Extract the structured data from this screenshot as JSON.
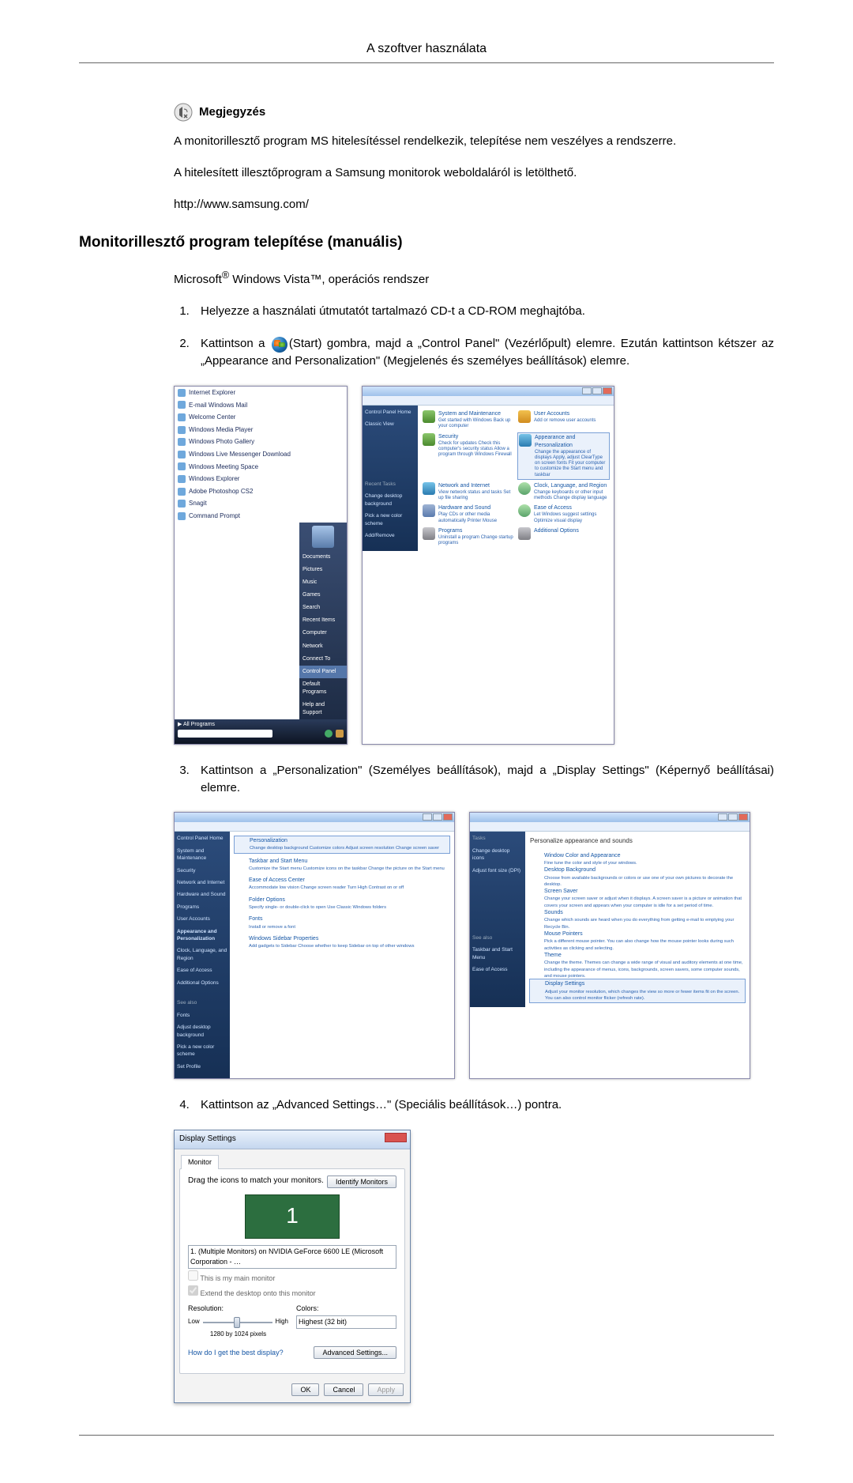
{
  "header": {
    "title": "A szoftver használata"
  },
  "note": {
    "label": "Megjegyzés",
    "p1": "A monitorillesztő program MS hitelesítéssel rendelkezik, telepítése nem veszélyes a rendszerre.",
    "p2": "A hitelesített illesztőprogram a Samsung monitorok weboldaláról is letölthető.",
    "url": "http://www.samsung.com/"
  },
  "section_title": "Monitorillesztő program telepítése (manuális)",
  "subtitle_pre": "Microsoft",
  "subtitle_post": " Windows Vista™, operációs rendszer",
  "steps": {
    "s1": "Helyezze a használati útmutatót tartalmazó CD-t a CD-ROM meghajtóba.",
    "s2_pre": "Kattintson a ",
    "s2_post": "(Start) gombra, majd a „Control Panel\" (Vezérlőpult) elemre. Ezután kattintson kétszer az „Appearance and Personalization\" (Megjelenés és személyes beállítások) elemre.",
    "s3": "Kattintson a „Personalization\" (Személyes beállítások), majd a „Display Settings\" (Képernyő beállításai) elemre.",
    "s4": "Kattintson az „Advanced Settings…\" (Speciális beállítások…) pontra."
  },
  "startmenu": {
    "items": [
      "Internet Explorer",
      "E-mail Windows Mail",
      "Welcome Center",
      "Windows Media Player",
      "Windows Photo Gallery",
      "Windows Live Messenger Download",
      "Windows Meeting Space",
      "Windows Explorer",
      "Adobe Photoshop CS2",
      "Snagit",
      "Command Prompt"
    ],
    "all_programs": "All Programs",
    "right_items": [
      "Documents",
      "Pictures",
      "Music",
      "Games",
      "Search",
      "Recent Items",
      "Computer",
      "Network",
      "Connect To",
      "Control Panel",
      "Default Programs",
      "Help and Support"
    ],
    "highlight_index": 9,
    "user_icon_alt": "user-avatar"
  },
  "controlpanel": {
    "side": {
      "home": "Control Panel Home",
      "classic": "Classic View",
      "recent": "Recent Tasks",
      "r1": "Change desktop background",
      "r2": "Pick a new color scheme",
      "r3": "Add/Remove"
    },
    "cats": [
      {
        "h": "System and Maintenance",
        "s": "Get started with Windows\nBack up your computer"
      },
      {
        "h": "User Accounts",
        "s": "Add or remove user accounts"
      },
      {
        "h": "Security",
        "s": "Check for updates\nCheck this computer's security status\nAllow a program through Windows Firewall"
      },
      {
        "h": "Appearance and Personalization",
        "s": "Change the appearance of displays\nApply, adjust ClearType on screen fonts\nFit your computer to customize the Start menu and taskbar"
      },
      {
        "h": "Network and Internet",
        "s": "View network status and tasks\nSet up file sharing"
      },
      {
        "h": "Clock, Language, and Region",
        "s": "Change keyboards or other input methods\nChange display language"
      },
      {
        "h": "Hardware and Sound",
        "s": "Play CDs or other media automatically\nPrinter\nMouse"
      },
      {
        "h": "Ease of Access",
        "s": "Let Windows suggest settings\nOptimize visual display"
      },
      {
        "h": "Programs",
        "s": "Uninstall a program\nChange startup programs"
      },
      {
        "h": "Additional Options",
        "s": ""
      }
    ],
    "hl_index": 3
  },
  "personal_left": {
    "side_links": [
      "Control Panel Home",
      "System and Maintenance",
      "Security",
      "Network and Internet",
      "Hardware and Sound",
      "Programs",
      "User Accounts",
      "Appearance and Personalization",
      "Clock, Language, and Region",
      "Ease of Access",
      "Additional Options"
    ],
    "side_sel": 7,
    "see_also": "See also",
    "see_links": [
      "Fonts",
      "Adjust desktop background",
      "Pick a new color scheme",
      "Set Profile"
    ],
    "items": [
      {
        "h": "Personalization",
        "s": "Change desktop background   Customize colors   Adjust screen resolution   Change screen saver"
      },
      {
        "h": "Taskbar and Start Menu",
        "s": "Customize the Start menu   Customize icons on the taskbar   Change the picture on the Start menu"
      },
      {
        "h": "Ease of Access Center",
        "s": "Accommodate low vision   Change screen reader   Turn High Contrast on or off"
      },
      {
        "h": "Folder Options",
        "s": "Specify single- or double-click to open   Use Classic Windows folders"
      },
      {
        "h": "Fonts",
        "s": "Install or remove a font"
      },
      {
        "h": "Windows Sidebar Properties",
        "s": "Add gadgets to Sidebar   Choose whether to keep Sidebar on top of other windows"
      }
    ],
    "hl_index": 0
  },
  "personal_right": {
    "side": {
      "tasks": "Tasks",
      "t1": "Change desktop icons",
      "t2": "Adjust font size (DPI)"
    },
    "see_also": "See also",
    "see_links": [
      "Taskbar and Start Menu",
      "Ease of Access"
    ],
    "heading": "Personalize appearance and sounds",
    "items": [
      {
        "h": "Window Color and Appearance",
        "s": "Fine tune the color and style of your windows."
      },
      {
        "h": "Desktop Background",
        "s": "Choose from available backgrounds or colors or use one of your own pictures to decorate the desktop."
      },
      {
        "h": "Screen Saver",
        "s": "Change your screen saver or adjust when it displays. A screen saver is a picture or animation that covers your screen and appears when your computer is idle for a set period of time."
      },
      {
        "h": "Sounds",
        "s": "Change which sounds are heard when you do everything from getting e-mail to emptying your Recycle Bin."
      },
      {
        "h": "Mouse Pointers",
        "s": "Pick a different mouse pointer. You can also change how the mouse pointer looks during such activities as clicking and selecting."
      },
      {
        "h": "Theme",
        "s": "Change the theme. Themes can change a wide range of visual and auditory elements at one time, including the appearance of menus, icons, backgrounds, screen savers, some computer sounds, and mouse pointers."
      },
      {
        "h": "Display Settings",
        "s": "Adjust your monitor resolution, which changes the view so more or fewer items fit on the screen. You can also control monitor flicker (refresh rate)."
      }
    ],
    "hl_index": 6
  },
  "dlg": {
    "title": "Display Settings",
    "tab": "Monitor",
    "drag": "Drag the icons to match your monitors.",
    "identify": "Identify Monitors",
    "monitor_num": "1",
    "combo": "1. (Multiple Monitors) on NVIDIA GeForce 6600 LE (Microsoft Corporation - …",
    "chk_main": "This is my main monitor",
    "chk_extend": "Extend the desktop onto this monitor",
    "res_label": "Resolution:",
    "res_low": "Low",
    "res_high": "High",
    "res_value": "1280 by 1024 pixels",
    "color_label": "Colors:",
    "color_value": "Highest (32 bit)",
    "help": "How do I get the best display?",
    "advanced": "Advanced Settings...",
    "ok": "OK",
    "cancel": "Cancel",
    "apply": "Apply"
  }
}
